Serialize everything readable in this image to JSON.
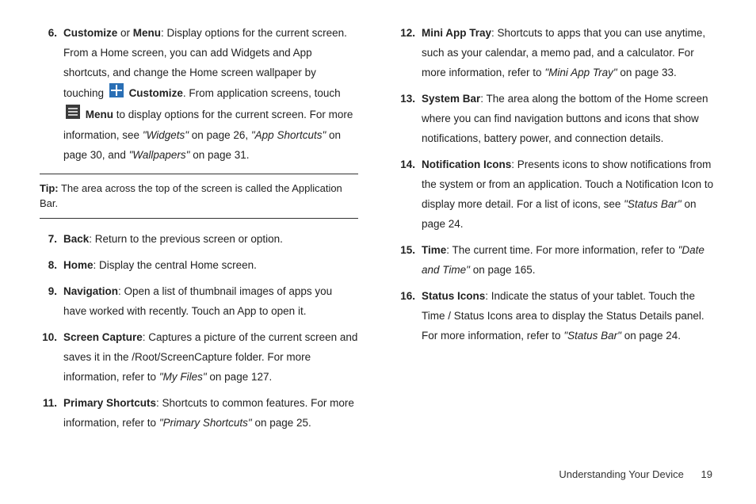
{
  "left": {
    "item6": {
      "num": "6.",
      "title": "Customize",
      "or": " or ",
      "title2": "Menu",
      "pre": ": Display options for the current screen. From a Home screen, you can add Widgets and App shortcuts, and change the Home screen wallpaper by touching ",
      "customize": "Customize",
      "mid": ". From application screens, touch ",
      "menu": "Menu",
      "post": " to display options for the current screen. For more information, see ",
      "ref1": "\"Widgets\"",
      "ref1p": " on page 26, ",
      "ref2": "\"App Shortcuts\"",
      "ref2p": " on page 30, and ",
      "ref3": "\"Wallpapers\"",
      "ref3p": " on page 31."
    },
    "tip": {
      "label": "Tip:",
      "text": " The area across the top of the screen is called the Application Bar."
    },
    "item7": {
      "num": "7.",
      "title": "Back",
      "text": ": Return to the previous screen or option."
    },
    "item8": {
      "num": "8.",
      "title": "Home",
      "text": ": Display the central Home screen."
    },
    "item9": {
      "num": "9.",
      "title": "Navigation",
      "text": ": Open a list of thumbnail images of apps you have worked with recently. Touch an App to open it."
    },
    "item10": {
      "num": "10.",
      "title": "Screen Capture",
      "pre": ": Captures a picture of the current screen and saves it in the /Root/ScreenCapture folder. For more information, refer to ",
      "ref": "\"My Files\" ",
      "post": " on page 127."
    },
    "item11": {
      "num": "11.",
      "title": "Primary Shortcuts",
      "pre": ": Shortcuts to common features. For more information, refer to ",
      "ref": "\"Primary Shortcuts\" ",
      "post": " on page 25."
    }
  },
  "right": {
    "item12": {
      "num": "12.",
      "title": "Mini App Tray",
      "pre": ": Shortcuts to apps that you can use anytime, such as your calendar, a memo pad, and a calculator. For more information, refer to ",
      "ref": "\"Mini App Tray\" ",
      "post": " on page 33."
    },
    "item13": {
      "num": "13.",
      "title": "System Bar",
      "text": ": The area along the bottom of the Home screen where you can find navigation buttons and icons that show notifications, battery power, and connection details."
    },
    "item14": {
      "num": "14.",
      "title": "Notification Icons",
      "pre": ": Presents icons to show notifications from the system or from an application. Touch a Notification Icon to display more detail. For a list of icons, see ",
      "ref": "\"Status Bar\"",
      "post": " on page 24."
    },
    "item15": {
      "num": "15.",
      "title": "Time",
      "pre": ": The current time. For more information, refer to ",
      "ref": "\"Date and Time\" ",
      "post": " on page 165."
    },
    "item16": {
      "num": "16.",
      "title": "Status Icons",
      "pre": ": Indicate the status of your tablet. Touch the Time / Status Icons area to display the Status Details panel. For more information, refer to ",
      "ref": "\"Status Bar\" ",
      "post": " on page 24."
    }
  },
  "footer": {
    "section": "Understanding Your Device",
    "page": "19"
  }
}
